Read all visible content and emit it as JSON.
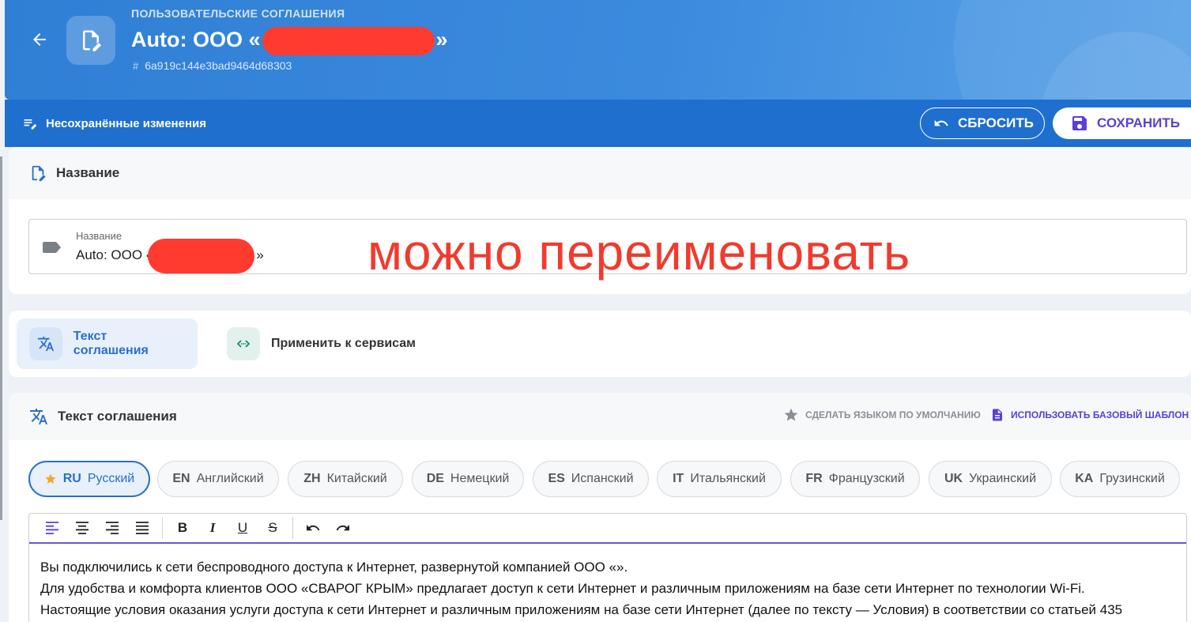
{
  "header": {
    "overline": "ПОЛЬЗОВАТЕЛЬСКИЕ СОГЛАШЕНИЯ",
    "title_prefix": "Auto: ООО «",
    "title_suffix": "»",
    "record_id": "6a919c144e3bad9464d68303",
    "back_icon": "arrow-left-icon",
    "doc_icon": "document-edit-icon"
  },
  "unsaved_bar": {
    "label": "Несохранённые изменения",
    "reset_label": "СБРОСИТЬ",
    "save_label": "СОХРАНИТЬ"
  },
  "name_card": {
    "title": "Название",
    "field_label": "Название",
    "field_value": "Auto: ООО «",
    "field_value_suffix": "»"
  },
  "annotation": "можно переименовать",
  "tabs": [
    {
      "label": "Текст соглашения",
      "active": true,
      "icon": "translate-icon"
    },
    {
      "label": "Применить к сервисам",
      "active": false,
      "icon": "api-icon"
    }
  ],
  "text_card": {
    "title": "Текст соглашения",
    "make_default": "СДЕЛАТЬ ЯЗЫКОМ ПО УМОЛЧАНИЮ",
    "use_template": "ИСПОЛЬЗОВАТЬ БАЗОВЫЙ ШАБЛОН"
  },
  "languages": [
    {
      "code": "RU",
      "name": "Русский",
      "active": true
    },
    {
      "code": "EN",
      "name": "Английский",
      "active": false
    },
    {
      "code": "ZH",
      "name": "Китайский",
      "active": false
    },
    {
      "code": "DE",
      "name": "Немецкий",
      "active": false
    },
    {
      "code": "ES",
      "name": "Испанский",
      "active": false
    },
    {
      "code": "IT",
      "name": "Итальянский",
      "active": false
    },
    {
      "code": "FR",
      "name": "Французский",
      "active": false
    },
    {
      "code": "UK",
      "name": "Украинский",
      "active": false
    },
    {
      "code": "KA",
      "name": "Грузинский",
      "active": false
    }
  ],
  "toolbar": {
    "bold": "B",
    "italic": "I",
    "underline": "U",
    "strike": "S"
  },
  "editor_lines": [
    "Вы подключились к сети беспроводного доступа к Интернет, развернутой компанией ООО «».",
    "Для удобства и комфорта клиентов ООО «СВАРОГ КРЫМ» предлагает доступ к сети Интернет и различным приложениям на базе сети Интернет по технологии Wi-Fi.",
    "Настоящие условия оказания услуги доступа к сети Интернет и различным приложениям на базе сети Интернет (далее по тексту — Условия) в соответствии со статьей 435"
  ],
  "colors": {
    "header_blue": "#3b8ade",
    "bar_blue": "#1f6fcf",
    "accent_purple": "#5b3fd6",
    "annotation_red": "#f13a2e"
  }
}
